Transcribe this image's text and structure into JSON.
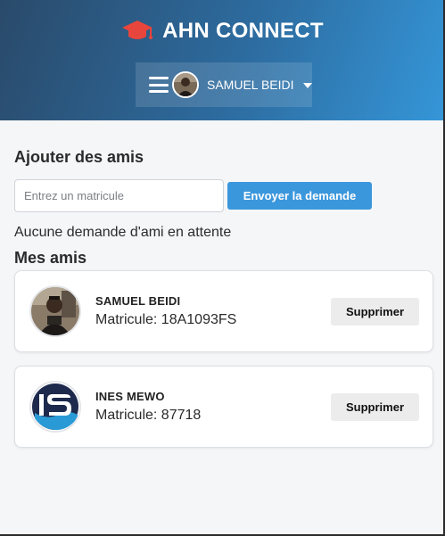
{
  "header": {
    "brand_title": "AHN CONNECT",
    "brand_icon": "graduation-cap-icon",
    "brand_icon_color": "#e8453c",
    "user_name": "SAMUEL BEIDI"
  },
  "add_friends": {
    "title": "Ajouter des amis",
    "input_placeholder": "Entrez un matricule",
    "input_value": "",
    "send_label": "Envoyer la demande",
    "pending_text": "Aucune demande d'ami en attente"
  },
  "friends": {
    "title": "Mes amis",
    "items": [
      {
        "name": "SAMUEL BEIDI",
        "matricule": "Matricule: 18A1093FS",
        "delete_label": "Supprimer"
      },
      {
        "name": "INES MEWO",
        "matricule": "Matricule: 87718",
        "delete_label": "Supprimer"
      }
    ]
  },
  "colors": {
    "accent": "#3b97dc",
    "header_gradient_start": "#2a4a6a",
    "header_gradient_end": "#3596d8"
  }
}
